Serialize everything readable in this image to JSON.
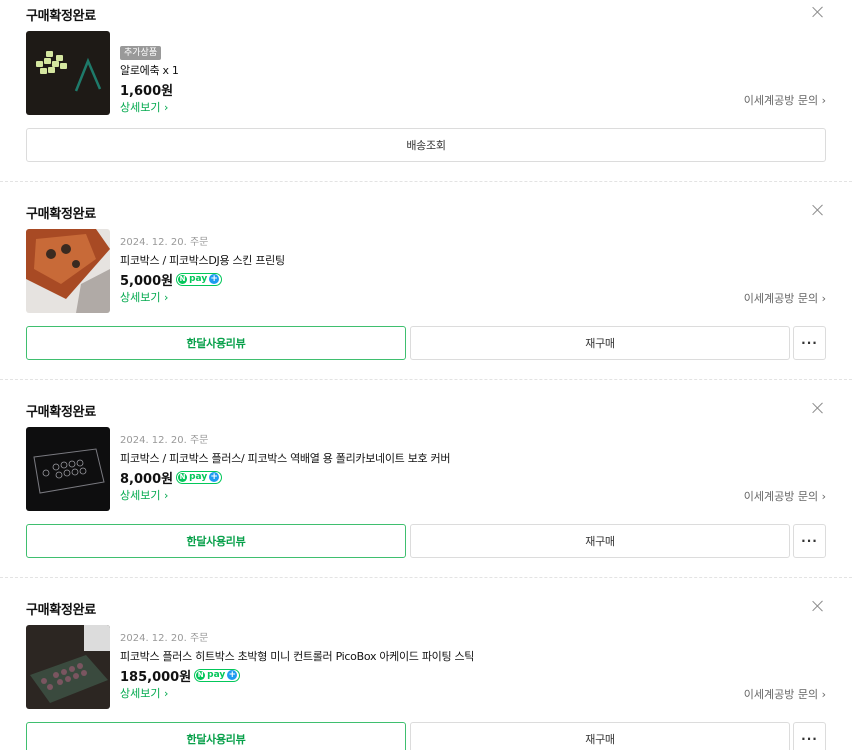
{
  "orders": [
    {
      "status": "구매확정완료",
      "badge": "추가상품",
      "date": "",
      "name": "알로에축 x 1",
      "price": "1,600원",
      "npay": false,
      "detail": "상세보기 ›",
      "seller": "이세계공방 문의 ›",
      "buttons": {
        "primary": "배송조회"
      },
      "thumb": "aloe-keycaps"
    },
    {
      "status": "구매확정완료",
      "date": "2024. 12. 20. 주문",
      "name": "피코박스 / 피코박스DJ용 스킨 프린팅",
      "price": "5,000원",
      "npay": true,
      "detail": "상세보기 ›",
      "seller": "이세계공방 문의 ›",
      "buttons": {
        "review": "한달사용리뷰",
        "rebuy": "재구매",
        "more": "···"
      },
      "thumb": "skin-printing"
    },
    {
      "status": "구매확정완료",
      "date": "2024. 12. 20. 주문",
      "name": "피코박스 / 피코박스 플러스/ 피코박스 역배열 용 폴리카보네이트 보호 커버",
      "price": "8,000원",
      "npay": true,
      "detail": "상세보기 ›",
      "seller": "이세계공방 문의 ›",
      "buttons": {
        "review": "한달사용리뷰",
        "rebuy": "재구매",
        "more": "···"
      },
      "thumb": "poly-cover"
    },
    {
      "status": "구매확정완료",
      "date": "2024. 12. 20. 주문",
      "name": "피코박스 플러스 히트박스 초박형 미니 컨트롤러 PicoBox 아케이드 파이팅 스틱",
      "price": "185,000원",
      "npay": true,
      "detail": "상세보기 ›",
      "seller": "이세계공방 문의 ›",
      "buttons": {
        "review": "한달사용리뷰",
        "rebuy": "재구매",
        "more": "···"
      },
      "thumb": "picobox-controller"
    }
  ],
  "npay_label": {
    "n": "N",
    "pay": "pay",
    "plus": "+"
  }
}
